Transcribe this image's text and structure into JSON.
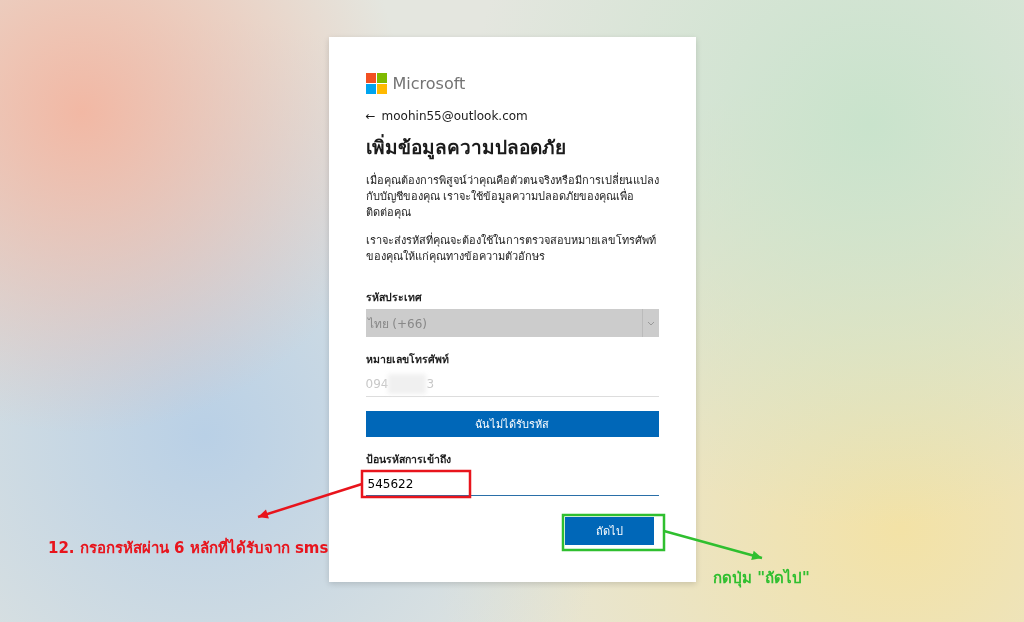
{
  "brand": {
    "name": "Microsoft"
  },
  "back": {
    "icon": "←",
    "email": "moohin55@outlook.com"
  },
  "title": "เพิ่มข้อมูลความปลอดภัย",
  "paragraphs": [
    "เมื่อคุณต้องการพิสูจน์ว่าคุณคือตัวตนจริงหรือมีการเปลี่ยนแปลงกับบัญชีของคุณ เราจะใช้ข้อมูลความปลอดภัยของคุณเพื่อติดต่อคุณ",
    "เราจะส่งรหัสที่คุณจะต้องใช้ในการตรวจสอบหมายเลขโทรศัพท์ของคุณให้แก่คุณทางข้อความตัวอักษร"
  ],
  "country": {
    "label": "รหัสประเทศ",
    "value": "ไทย (+66)",
    "disabled": true
  },
  "phone": {
    "label": "หมายเลขโทรศัพท์",
    "value_start": "094",
    "value_end": "3",
    "redacted": true,
    "disabled": true
  },
  "resend_button": "ฉันไม่ได้รับรหัส",
  "code": {
    "label": "ป้อนรหัสการเข้าถึง",
    "value": "545622"
  },
  "next_button": "ถัดไป",
  "annotations": [
    {
      "kind": "callout",
      "color": "#e8141c",
      "text": "12. กรอกรหัสผ่าน 6 หลักที่ได้รับจาก sms"
    },
    {
      "kind": "callout",
      "color": "#2fbf2f",
      "text": "กดปุ่ม \"ถัดไป\""
    }
  ]
}
